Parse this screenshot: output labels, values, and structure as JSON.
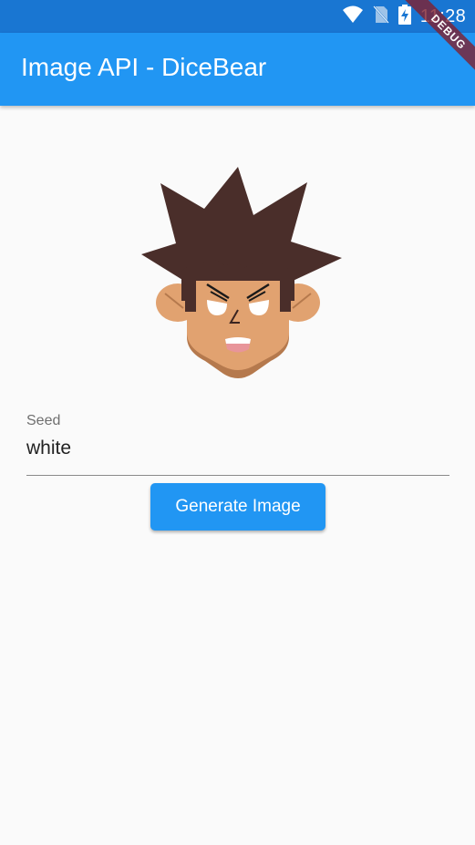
{
  "status_bar": {
    "time": "11:28",
    "icons": [
      "wifi-icon",
      "no-sim-icon",
      "battery-charging-icon"
    ],
    "color": "#1976d2"
  },
  "app_bar": {
    "title": "Image API - DiceBear",
    "color": "#2196f3"
  },
  "debug_banner": {
    "label": "DEBUG"
  },
  "avatar": {
    "description_icon": "avatar-image",
    "colors": {
      "hair": "#4a2e2a",
      "skin": "#e1a270",
      "chin": "#b5794d",
      "mouth": "#e8959a"
    }
  },
  "seed_field": {
    "label": "Seed",
    "value": "white"
  },
  "generate_button": {
    "label": "Generate Image"
  }
}
